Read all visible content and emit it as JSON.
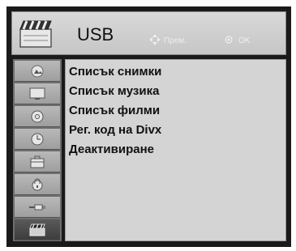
{
  "header": {
    "title": "USB",
    "hint_move": "Прем.",
    "hint_ok": "OK"
  },
  "sidebar": {
    "items": [
      {
        "icon": "picture-icon"
      },
      {
        "icon": "monitor-icon"
      },
      {
        "icon": "disc-icon"
      },
      {
        "icon": "clock-icon"
      },
      {
        "icon": "toolbox-icon"
      },
      {
        "icon": "lock-icon"
      },
      {
        "icon": "cable-icon"
      },
      {
        "icon": "usb-icon",
        "active": true
      }
    ]
  },
  "menu": {
    "items": [
      "Списък снимки",
      "Списък музика",
      "Списък филми",
      "Рег. код на Divx",
      "Деактивиране"
    ]
  }
}
